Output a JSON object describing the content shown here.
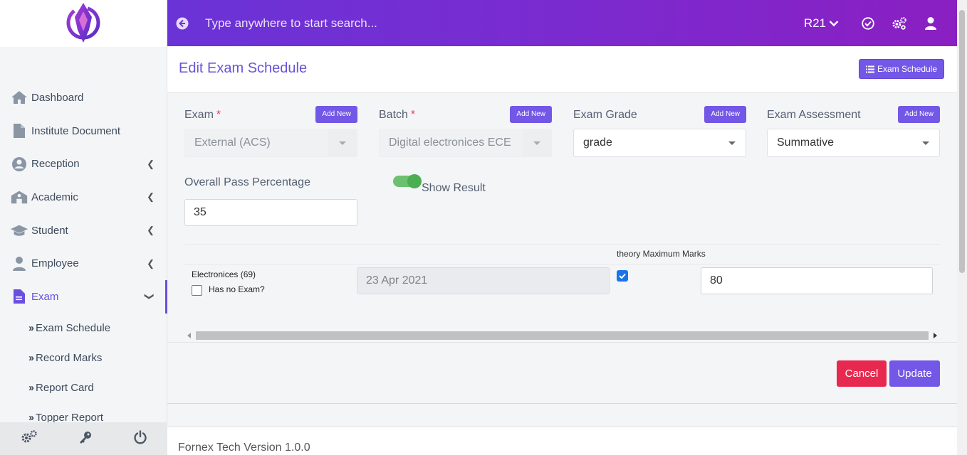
{
  "header": {
    "search_placeholder": "Type anywhere to start search...",
    "role": "R21"
  },
  "sidebar": {
    "menu": [
      {
        "label": "Dashboard"
      },
      {
        "label": "Institute Document"
      },
      {
        "label": "Reception"
      },
      {
        "label": "Academic"
      },
      {
        "label": "Student"
      },
      {
        "label": "Employee"
      },
      {
        "label": "Exam"
      }
    ],
    "exam_submenu": [
      {
        "label": "Exam Schedule"
      },
      {
        "label": "Record Marks"
      },
      {
        "label": "Report Card"
      },
      {
        "label": "Topper Report"
      }
    ]
  },
  "page": {
    "title": "Edit Exam Schedule",
    "schedule_button": "Exam Schedule"
  },
  "form": {
    "add_new_label": "Add New",
    "exam": {
      "label": "Exam",
      "required": "*",
      "value": "External (ACS)"
    },
    "batch": {
      "label": "Batch",
      "required": "*",
      "value": "Digital electronices ECE"
    },
    "grade": {
      "label": "Exam Grade",
      "value": "grade"
    },
    "assessment": {
      "label": "Exam Assessment",
      "value": "Summative"
    },
    "pass_percentage": {
      "label": "Overall Pass Percentage",
      "value": "35"
    },
    "show_result": {
      "label": "Show Result",
      "enabled": true
    }
  },
  "schedule_table": {
    "header_max_marks": "theory Maximum Marks",
    "rows": [
      {
        "subject": "Electronices (69)",
        "no_exam_label": "Has no Exam?",
        "no_exam_checked": false,
        "date": "23 Apr 2021",
        "theory_checked": true,
        "max_marks": "80"
      }
    ]
  },
  "actions": {
    "cancel": "Cancel",
    "update": "Update"
  },
  "footer": {
    "version": "Fornex Tech Version 1.0.0"
  },
  "colors": {
    "accent": "#7357e6",
    "header_gradient_start": "#6a33d6",
    "header_gradient_end": "#8a1fc2",
    "danger": "#e8294f",
    "toggle_on": "#4cae52"
  }
}
